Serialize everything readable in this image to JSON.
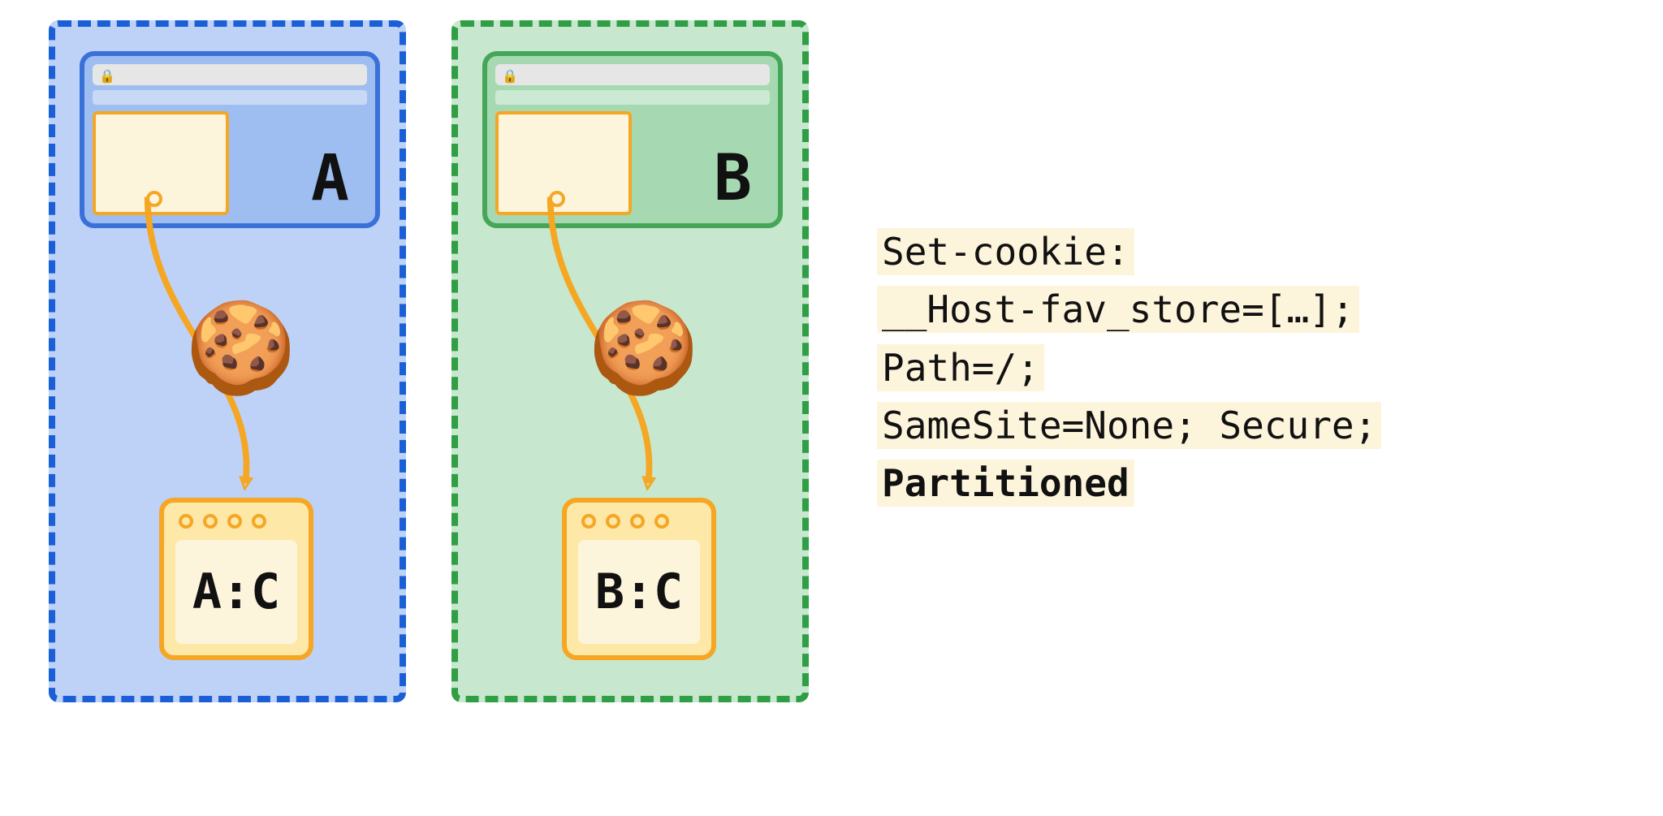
{
  "partitionA": {
    "site_label": "A",
    "jar_label": "A:C"
  },
  "partitionB": {
    "site_label": "B",
    "jar_label": "B:C"
  },
  "http": {
    "l1": "Set-cookie:",
    "l2": "__Host-fav_store=[…];",
    "l3": "Path=/;",
    "l4": "SameSite=None; Secure;",
    "l5": "Partitioned"
  },
  "cookie_emoji": "🍪"
}
